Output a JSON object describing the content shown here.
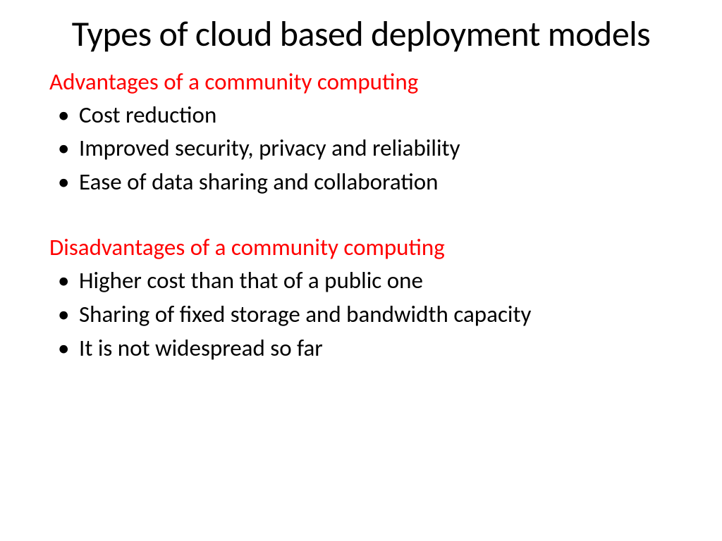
{
  "title": "Types of cloud based deployment models",
  "sections": [
    {
      "heading": "Advantages of a community computing",
      "items": [
        "Cost reduction",
        "Improved security, privacy and reliability",
        "Ease of data sharing and collaboration"
      ]
    },
    {
      "heading": "Disadvantages of a community computing",
      "items": [
        "Higher cost than that of a public one",
        "Sharing of fixed storage and bandwidth capacity",
        "It is not widespread so far"
      ]
    }
  ]
}
